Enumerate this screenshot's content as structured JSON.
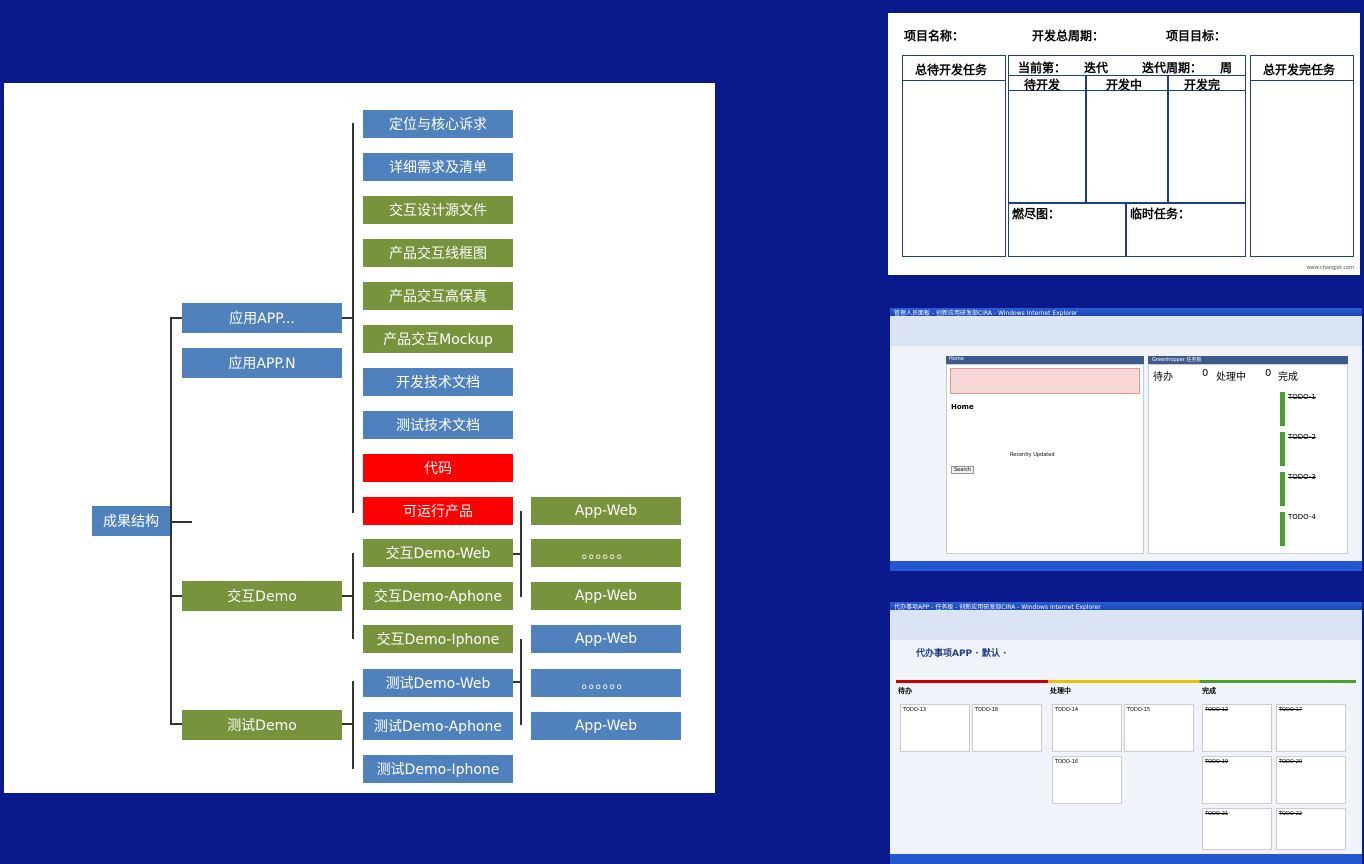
{
  "diagram": {
    "root": "成果结构",
    "level1": [
      "应用APP...",
      "应用APP.N",
      "交互Demo",
      "测试Demo"
    ],
    "app_children": [
      "定位与核心诉求",
      "详细需求及清单",
      "交互设计源文件",
      "产品交互线框图",
      "产品交互高保真",
      "产品交互Mockup",
      "开发技术文档",
      "测试技术文档",
      "代码",
      "可运行产品"
    ],
    "run_children": [
      "App-Web"
    ],
    "demo_children": [
      "交互Demo-Web",
      "交互Demo-Aphone",
      "交互Demo-Iphone"
    ],
    "demo_web_children": [
      "App-Web",
      "。。。。。。",
      "App-Web"
    ],
    "test_children": [
      "测试Demo-Web",
      "测试Demo-Aphone",
      "测试Demo-Iphone"
    ],
    "test_web_children": [
      "App-Web",
      "。。。。。。",
      "App-Web"
    ]
  },
  "kanban_template": {
    "project_name": "项目名称：",
    "dev_period": "开发总周期：",
    "project_goal": "项目目标：",
    "pending_total": "总待开发任务",
    "current_iter": "当前第：",
    "iter": "迭代",
    "iter_period": "迭代周期：",
    "week": "周",
    "done_total": "总开发完任务",
    "todo": "待开发",
    "doing": "开发中",
    "done": "开发完",
    "burndown": "燃尽图：",
    "temp_tasks": "临时任务：",
    "footer": "www.changjet.com"
  },
  "screenshot_mid": {
    "window_title": "管理人员面板 - 创新应用研发部CIRA - Windows Internet Explorer",
    "home_header": "Home",
    "board_header": "Greenhopper 任务板",
    "home_title": "Home",
    "col_todo": "待办",
    "col_todo_count": "0",
    "col_doing": "处理中",
    "col_doing_count": "0",
    "col_done": "完成",
    "cards": [
      "TODO-1",
      "TODO-2",
      "TODO-3",
      "TODO-4"
    ],
    "search_btn": "Search",
    "recent": "Recently Updated"
  },
  "screenshot_bot": {
    "window_title": "代办事项APP - 任务板 - 创新应用研发部CIRA - Windows Internet Explorer",
    "board_title": "代办事项APP · 默认 ·",
    "col_todo": "待办",
    "col_doing": "处理中",
    "col_done": "完成",
    "todo_cards": [
      "TODO-13",
      "TODO-18"
    ],
    "doing_cards": [
      "TODO-14",
      "TODO-15",
      "TODO-16"
    ],
    "done_cards": [
      "TODO-12",
      "TODO-17",
      "TODO-19",
      "TODO-20",
      "TODO-21",
      "TODO-22"
    ]
  },
  "colors": {
    "background": "#0a1a8c",
    "blue_box": "#4f81bd",
    "green_box": "#77933c",
    "red_box": "#ff0000"
  }
}
